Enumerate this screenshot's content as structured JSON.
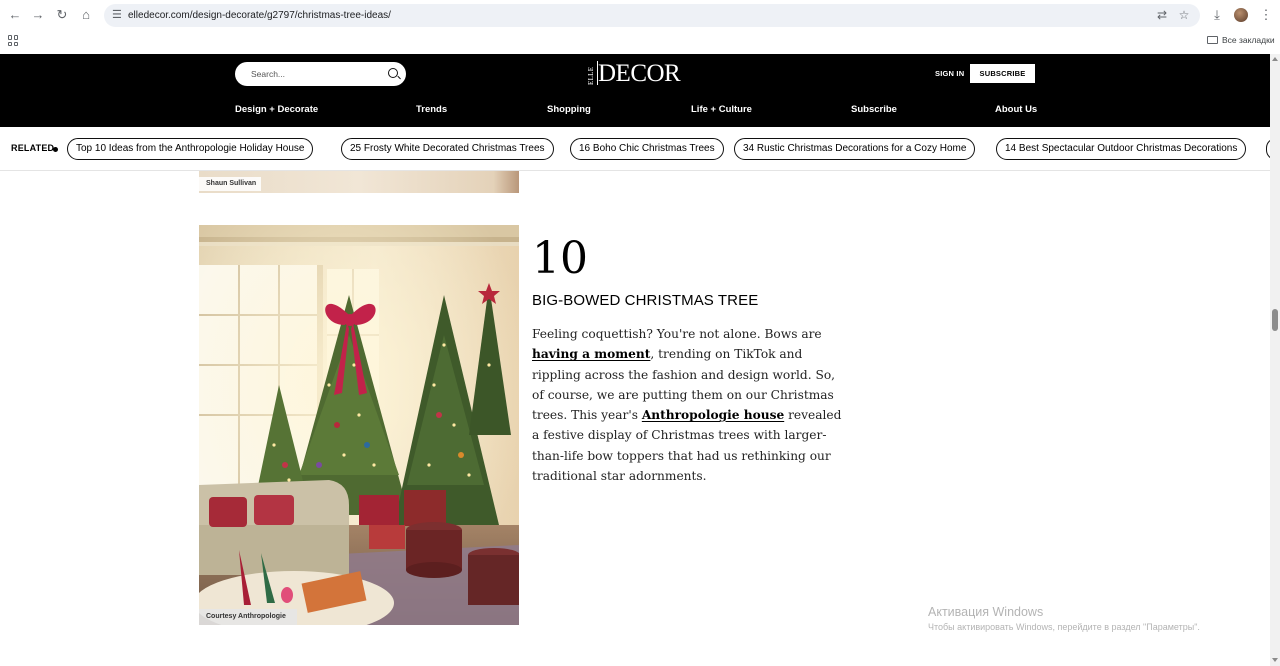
{
  "browser": {
    "url": "elledecor.com/design-decorate/g2797/christmas-tree-ideas/",
    "bookmarks_label": "Все закладки"
  },
  "header": {
    "search_placeholder": "Search...",
    "logo_small": "ELLE",
    "logo_main": "DECOR",
    "sign_in": "SIGN IN",
    "subscribe": "SUBSCRIBE",
    "nav": [
      "Design + Decorate",
      "Trends",
      "Shopping",
      "Life + Culture",
      "Subscribe",
      "About Us"
    ]
  },
  "related": {
    "label": "RELATED",
    "items": [
      "Top 10 Ideas from the Anthropologie Holiday House",
      "25 Frosty White Decorated Christmas Trees",
      "16 Boho Chic Christmas Trees",
      "34 Rustic Christmas Decorations for a Cozy Home",
      "14 Best Spectacular Outdoor Christmas Decorations"
    ]
  },
  "previous_slide": {
    "credit": "Shaun Sullivan"
  },
  "slide": {
    "number": "10",
    "title": "BIG-BOWED CHRISTMAS TREE",
    "image_credit": "Courtesy Anthropologie",
    "body": {
      "p1": "Feeling coquettish? You're not alone. Bows are ",
      "link1": "having a moment",
      "p2": ", trending on TikTok and rippling across the fashion and design world. So, of course, we are putting them on our Christmas trees. This year's ",
      "link2": "Anthropologie house",
      "p3": " revealed a festive display of Christmas trees with larger-than-life bow toppers that had us rethinking our traditional star adornments."
    }
  },
  "watermark": {
    "title": "Активация Windows",
    "subtitle": "Чтобы активировать Windows, перейдите в раздел \"Параметры\"."
  }
}
